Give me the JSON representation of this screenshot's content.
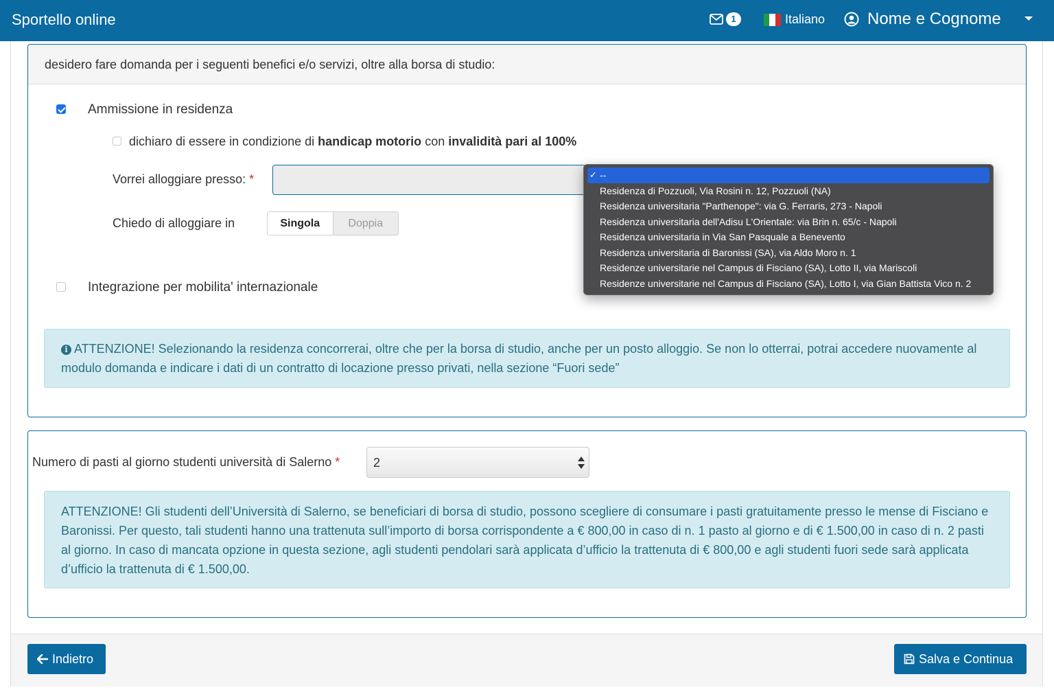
{
  "navbar": {
    "brand": "Sportello online",
    "mail_count": "1",
    "language": "Italiano",
    "user_name": "Nome e Cognome"
  },
  "benefits_panel": {
    "heading": "desidero fare domanda per i seguenti benefici e/o servizi, oltre alla borsa di studio:",
    "residence_label": "Ammissione in residenza",
    "residence_checked": true,
    "handicap_prefix": "dichiaro di essere in condizione di ",
    "handicap_bold1": "handicap motorio",
    "handicap_mid": " con ",
    "handicap_bold2": "invalidità pari al 100%",
    "handicap_checked": false,
    "lodging_label": "Vorrei alloggiare presso:",
    "required_mark": "*",
    "room_label": "Chiedo di alloggiare in",
    "room_options": [
      "Singola",
      "Doppia"
    ],
    "room_selected": "Singola",
    "mobility_label": "Integrazione per mobilita' internazionale",
    "mobility_checked": false,
    "alert": "ATTENZIONE! Selezionando la residenza concorrerai, oltre che per la borsa di studio, anche per un posto alloggio. Se non lo otterrai, potrai accedere nuovamente al modulo domanda e indicare i dati di un contratto di locazione presso privati, nella sezione “Fuori sede”"
  },
  "lodging_dropdown": {
    "selected_index": 0,
    "options": [
      "--",
      "Residenza di Pozzuoli, Via Rosini n. 12, Pozzuoli (NA)",
      "Residenza universitaria \"Parthenope\": via G. Ferraris, 273 - Napoli",
      "Residenza universitaria dell'Adisu L'Orientale: via Brin n. 65/c - Napoli",
      "Residenza universitaria in Via San Pasquale a Benevento",
      "Residenza universitaria di Baronissi (SA), via Aldo Moro n. 1",
      "Residenze universitarie nel Campus di Fisciano (SA), Lotto II, via Mariscoli",
      "Residenze universitarie nel Campus di Fisciano (SA), Lotto I, via Gian Battista Vico n. 2"
    ]
  },
  "meals_panel": {
    "label": "Numero di pasti al giorno studenti università di Salerno",
    "required_mark": "*",
    "value": "2",
    "alert": "ATTENZIONE! Gli studenti dell’Università di Salerno, se beneficiari di borsa di studio, possono scegliere di consumare i pasti gratuitamente presso le mense di Fisciano e Baronissi. Per questo, tali studenti hanno una trattenuta sull’importo di borsa corrispondente a € 800,00 in caso di n. 1 pasto al giorno e di € 1.500,00 in caso di n. 2 pasti al giorno. In caso di mancata opzione in questa sezione, agli studenti pendolari sarà applicata d’ufficio la trattenuta di € 800,00 e agli studenti fuori sede sarà applicata d’ufficio la trattenuta di € 1.500,00."
  },
  "footer": {
    "back_label": "Indietro",
    "save_label": "Salva e Continua"
  },
  "colors": {
    "primary": "#0b6aa0",
    "alert_bg": "#d4ecf1",
    "alert_text": "#2b6f83",
    "dropdown_bg": "#4b4b4d",
    "dropdown_selected": "#2563d9"
  }
}
